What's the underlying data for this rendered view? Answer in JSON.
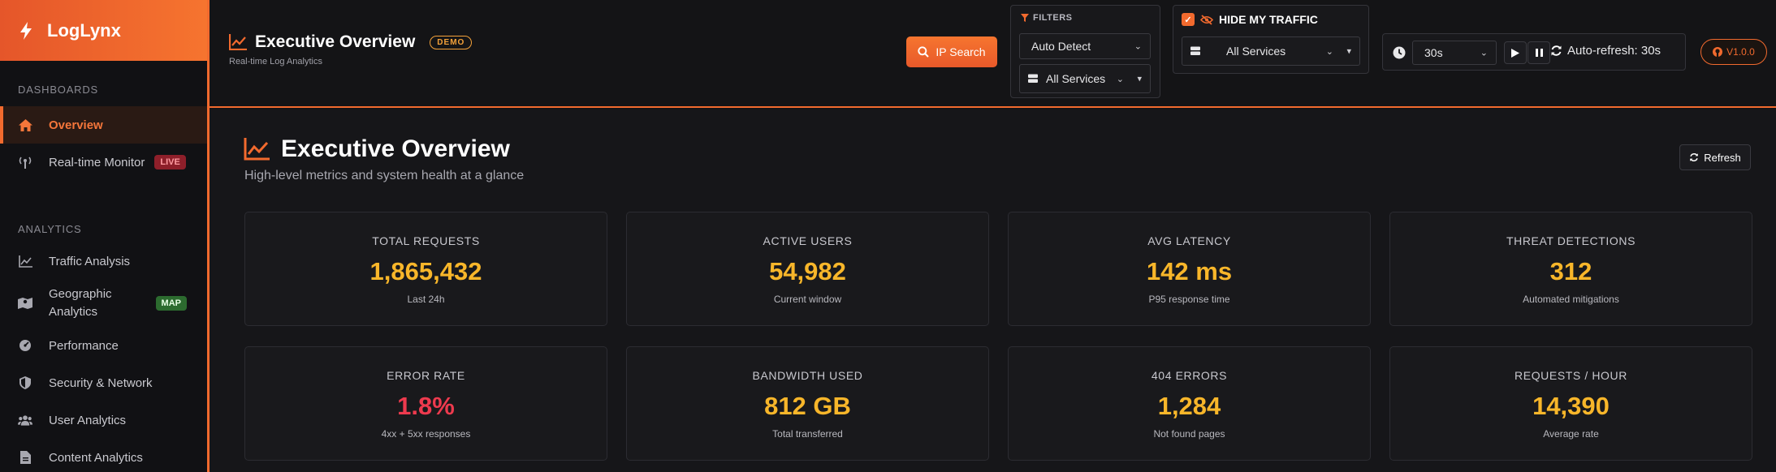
{
  "brand": {
    "name": "LogLynx",
    "icon": "bolt-icon"
  },
  "sidebar": {
    "sections": [
      {
        "label": "DASHBOARDS"
      },
      {
        "label": "ANALYTICS"
      }
    ],
    "items": [
      {
        "label": "Overview",
        "icon": "home-icon",
        "active": true
      },
      {
        "label": "Real-time Monitor",
        "icon": "antenna-icon",
        "badge": "LIVE"
      },
      {
        "label": "Traffic Analysis",
        "icon": "line-chart-icon"
      },
      {
        "label": "Geographic Analytics",
        "icon": "map-icon",
        "badge": "MAP"
      },
      {
        "label": "Performance",
        "icon": "gauge-icon"
      },
      {
        "label": "Security & Network",
        "icon": "shield-icon"
      },
      {
        "label": "User Analytics",
        "icon": "users-icon"
      },
      {
        "label": "Content Analytics",
        "icon": "file-icon"
      }
    ]
  },
  "topbar": {
    "title": "Executive Overview",
    "demo_badge": "DEMO",
    "subtitle": "Real-time Log Analytics",
    "ip_search_label": "IP Search",
    "filters_label": "FILTERS",
    "filter_format": "Auto Detect",
    "filter_services": "All Services",
    "hide_traffic_label": "HIDE MY TRAFFIC",
    "hide_traffic_checked": true,
    "hide_services": "All Services",
    "interval": "30s",
    "auto_refresh_text": "Auto-refresh: 30s",
    "version": "V1.0.0"
  },
  "page": {
    "title": "Executive Overview",
    "subtitle": "High-level metrics and system health at a glance",
    "refresh_label": "Refresh"
  },
  "cards": [
    {
      "label": "TOTAL REQUESTS",
      "value": "1,865,432",
      "sub": "Last 24h"
    },
    {
      "label": "ACTIVE USERS",
      "value": "54,982",
      "sub": "Current window"
    },
    {
      "label": "AVG LATENCY",
      "value": "142 ms",
      "sub": "P95 response time"
    },
    {
      "label": "THREAT DETECTIONS",
      "value": "312",
      "sub": "Automated mitigations"
    },
    {
      "label": "ERROR RATE",
      "value": "1.8%",
      "sub": "4xx + 5xx responses"
    },
    {
      "label": "BANDWIDTH USED",
      "value": "812 GB",
      "sub": "Total transferred"
    },
    {
      "label": "404 ERRORS",
      "value": "1,284",
      "sub": "Not found pages"
    },
    {
      "label": "REQUESTS / HOUR",
      "value": "14,390",
      "sub": "Average rate"
    }
  ],
  "colors": {
    "accent": "#f26a2e",
    "value": "#f8b62a",
    "error": "#ee3a4e"
  }
}
